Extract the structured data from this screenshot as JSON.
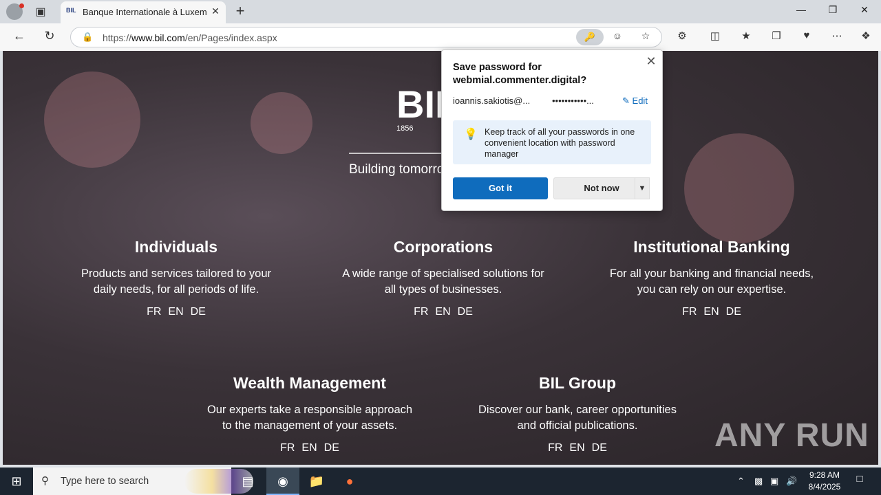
{
  "browser": {
    "tab_title": "Banque Internationale à Luxembourg",
    "tab_favicon": "BIL",
    "url_prefix": "https://",
    "url_domain": "www.bil.com",
    "url_path": "/en/Pages/index.aspx"
  },
  "hero": {
    "logo_text": "BIL",
    "logo_year": "1856",
    "tagline": "Building tomorrow"
  },
  "sections": [
    {
      "title": "Individuals",
      "description": "Products and services tailored to your daily needs, for all periods of life.",
      "langs": [
        "FR",
        "EN",
        "DE"
      ]
    },
    {
      "title": "Corporations",
      "description": "A wide range of specialised solutions for all types of businesses.",
      "langs": [
        "FR",
        "EN",
        "DE"
      ]
    },
    {
      "title": "Institutional Banking",
      "description": "For all your banking and financial needs, you can rely on our expertise.",
      "langs": [
        "FR",
        "EN",
        "DE"
      ]
    },
    {
      "title": "Wealth Management",
      "description": "Our experts take a responsible approach to the management of your assets.",
      "langs": [
        "FR",
        "EN",
        "DE"
      ]
    },
    {
      "title": "BIL Group",
      "description": "Discover our bank, career opportunities and official publications.",
      "langs": [
        "FR",
        "EN",
        "DE"
      ]
    }
  ],
  "popup": {
    "title": "Save password for webmial.commenter.digital?",
    "username": "ioannis.sakiotis@...",
    "password": "•••••••••••...",
    "edit_label": "Edit",
    "tip": "Keep track of all your passwords in one convenient location with password manager",
    "got_it": "Got it",
    "not_now": "Not now"
  },
  "watermark": "ANY RUN",
  "taskbar": {
    "search_placeholder": "Type here to search",
    "time": "9:28 AM",
    "date": "8/4/2025"
  },
  "colors": {
    "accent": "#0f6cbd",
    "taskbar": "#1c2530",
    "tip_bg": "#e8f1fb"
  }
}
